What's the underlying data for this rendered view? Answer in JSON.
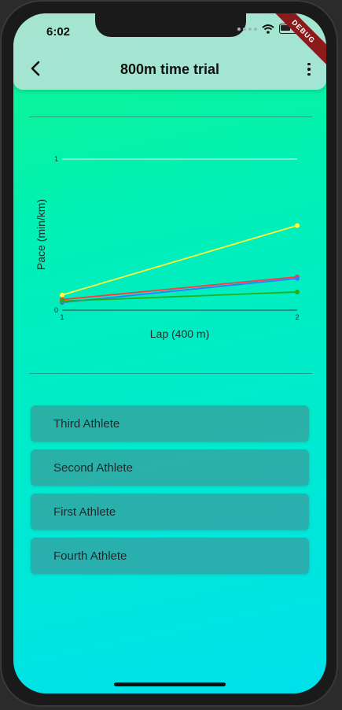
{
  "status": {
    "time": "6:02"
  },
  "app_bar": {
    "title": "800m time trial",
    "back_icon": "chevron-left-icon",
    "more_icon": "more-vertical-icon"
  },
  "debug_banner": "DEBUG",
  "chart_data": {
    "type": "line",
    "xlabel": "Lap (400 m)",
    "ylabel": "Pace (min/km)",
    "x": [
      1,
      2
    ],
    "xticks": [
      "1",
      "2"
    ],
    "yticks": [
      "0",
      "1"
    ],
    "ylim": [
      0,
      1
    ],
    "grid": true,
    "series": [
      {
        "color": "#ffff33",
        "values": [
          0.1,
          0.56
        ]
      },
      {
        "color": "#ff3b3b",
        "values": [
          0.07,
          0.22
        ]
      },
      {
        "color": "#2f7bff",
        "values": [
          0.05,
          0.21
        ]
      },
      {
        "color": "#21b21a",
        "values": [
          0.06,
          0.12
        ]
      }
    ]
  },
  "athletes": [
    {
      "label": "Third Athlete"
    },
    {
      "label": "Second Athlete"
    },
    {
      "label": "First Athlete"
    },
    {
      "label": "Fourth Athlete"
    }
  ]
}
